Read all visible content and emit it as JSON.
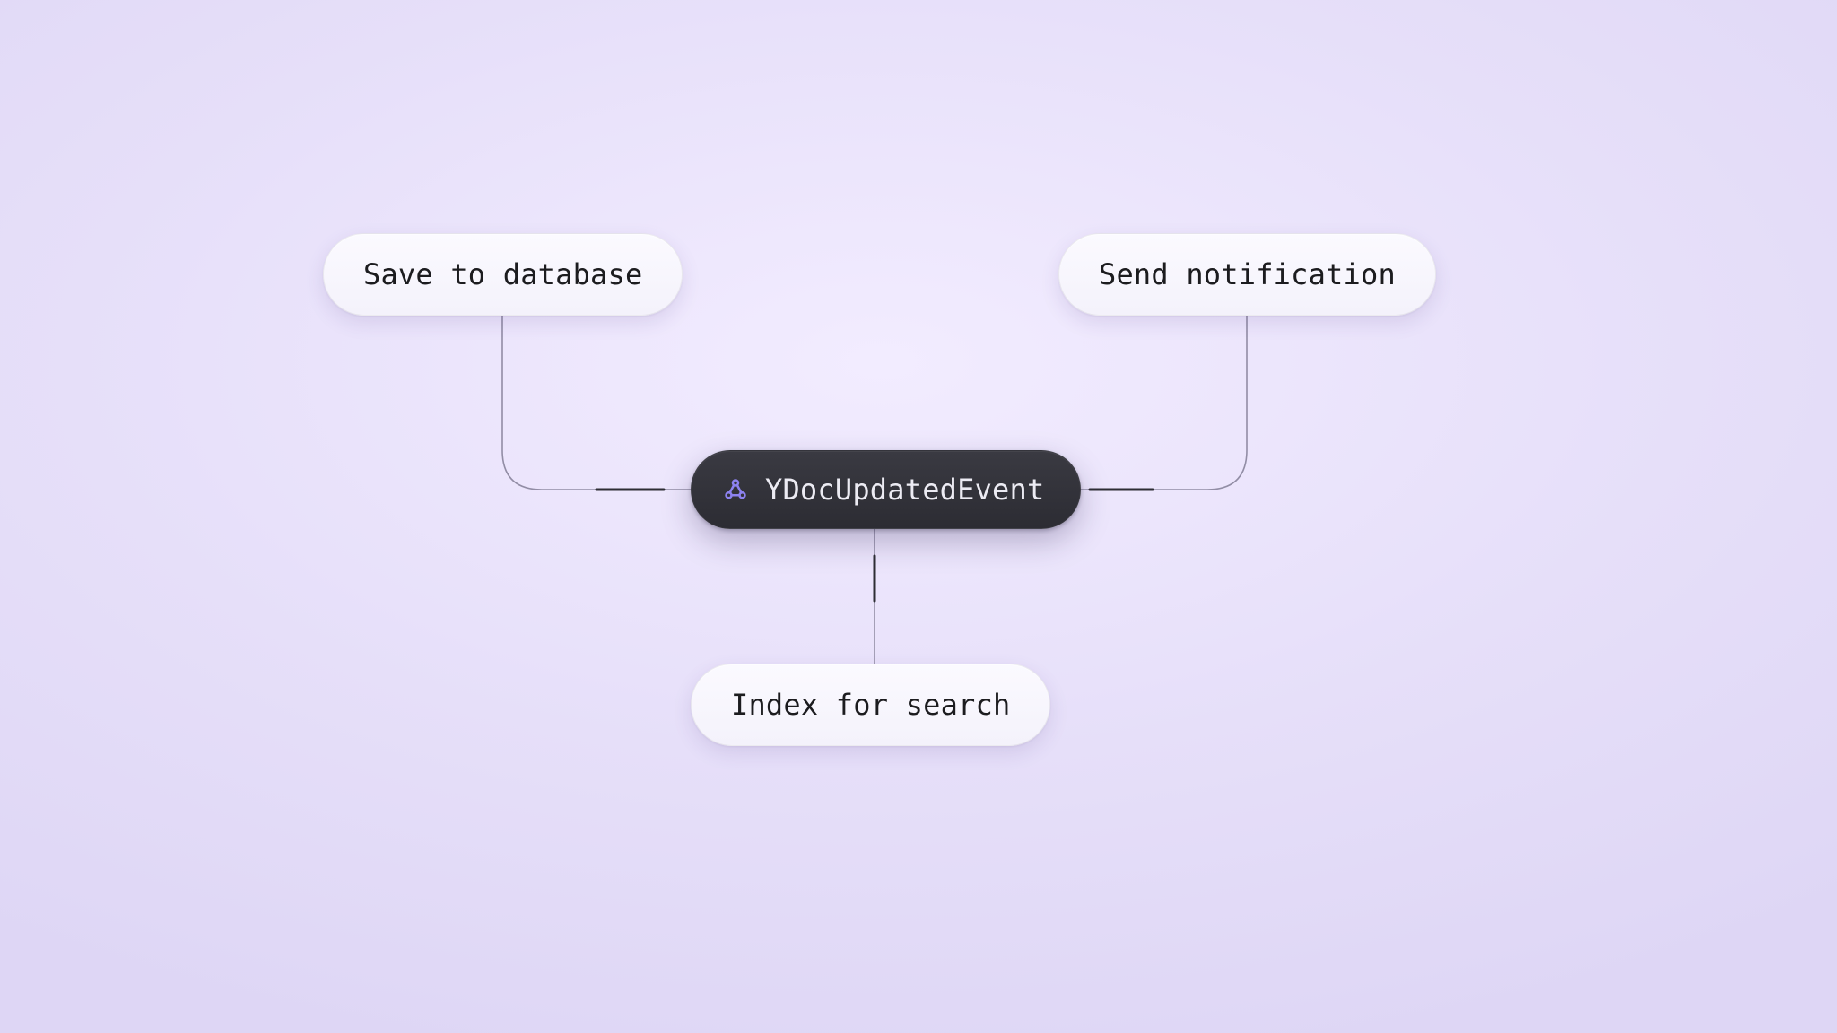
{
  "diagram": {
    "center": {
      "label": "YDocUpdatedEvent",
      "icon": "webhook-icon"
    },
    "nodes": {
      "save_database": {
        "label": "Save to database"
      },
      "send_notification": {
        "label": "Send notification"
      },
      "index_search": {
        "label": "Index for search"
      }
    },
    "colors": {
      "background": "#e6dff9",
      "node_light_bg": "#f8f6fe",
      "node_dark_bg": "#2f2f36",
      "accent_icon": "#8d82f0",
      "connector": "#8d88a0"
    }
  }
}
